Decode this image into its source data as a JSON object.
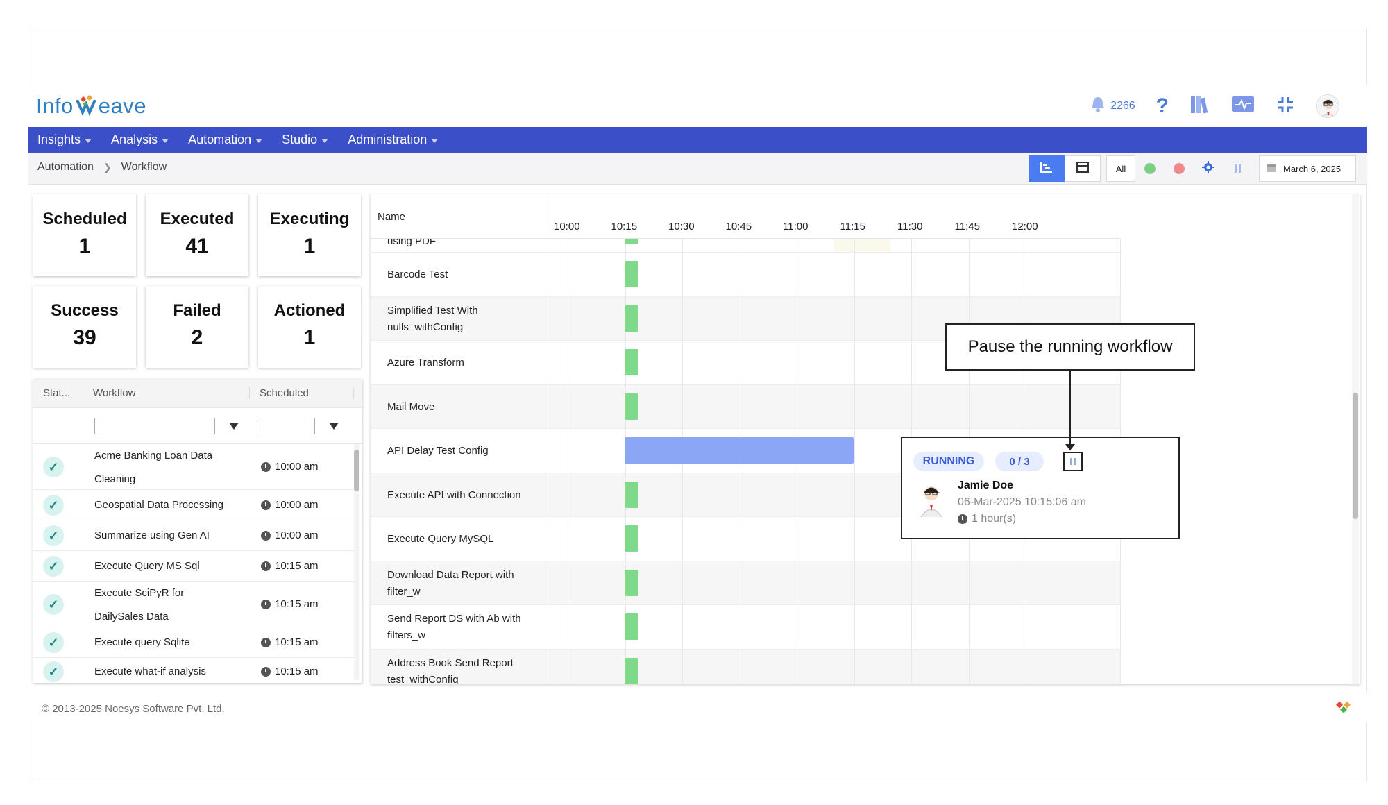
{
  "app": {
    "logo_prefix": "Info",
    "logo_suffix": "eave",
    "notifications_count": "2266"
  },
  "nav": {
    "items": [
      {
        "label": "Insights"
      },
      {
        "label": "Analysis"
      },
      {
        "label": "Automation"
      },
      {
        "label": "Studio"
      },
      {
        "label": "Administration"
      }
    ]
  },
  "breadcrumb": {
    "items": [
      "Automation",
      "Workflow"
    ]
  },
  "toolbar": {
    "filter_all": "All",
    "date": "March 6, 2025"
  },
  "stats": [
    {
      "title": "Scheduled",
      "value": "1"
    },
    {
      "title": "Executed",
      "value": "41"
    },
    {
      "title": "Executing",
      "value": "1"
    },
    {
      "title": "Success",
      "value": "39"
    },
    {
      "title": "Failed",
      "value": "2"
    },
    {
      "title": "Actioned",
      "value": "1"
    }
  ],
  "table": {
    "columns": [
      "Stat...",
      "Workflow",
      "Scheduled"
    ],
    "rows": [
      {
        "workflow": "Acme Banking Loan Data Cleaning",
        "scheduled": "10:00 am"
      },
      {
        "workflow": "Geospatial Data Processing",
        "scheduled": "10:00 am"
      },
      {
        "workflow": "Summarize using Gen AI",
        "scheduled": "10:00 am"
      },
      {
        "workflow": "Execute Query MS Sql",
        "scheduled": "10:15 am"
      },
      {
        "workflow": "Execute SciPyR for DailySales Data",
        "scheduled": "10:15 am"
      },
      {
        "workflow": "Execute query Sqlite",
        "scheduled": "10:15 am"
      },
      {
        "workflow": "Execute what-if analysis sales",
        "scheduled": "10:15 am"
      }
    ]
  },
  "gantt": {
    "name_header": "Name",
    "ticks": [
      "10:00",
      "10:15",
      "10:30",
      "10:45",
      "11:00",
      "11:15",
      "11:30",
      "11:45",
      "12:00"
    ],
    "partial_top_label": "using PDF",
    "rows": [
      {
        "name": "Barcode Test",
        "start": "10:15",
        "status": "success"
      },
      {
        "name": "Simplified Test With nulls_withConfig",
        "start": "10:15",
        "status": "success"
      },
      {
        "name": "Azure Transform",
        "start": "10:15",
        "status": "success"
      },
      {
        "name": "Mail Move",
        "start": "10:15",
        "status": "success"
      },
      {
        "name": "API Delay Test Config",
        "start": "10:15",
        "end": "11:15",
        "status": "running"
      },
      {
        "name": "Execute API with Connection",
        "start": "10:15",
        "status": "success"
      },
      {
        "name": "Execute Query MySQL",
        "start": "10:15",
        "status": "success"
      },
      {
        "name": "Download Data Report with filter_w",
        "start": "10:15",
        "status": "success"
      },
      {
        "name": "Send Report DS with Ab with filters_w",
        "start": "10:15",
        "status": "success"
      },
      {
        "name": "Address Book Send Report test_withConfig",
        "start": "10:15",
        "status": "success"
      }
    ]
  },
  "popup": {
    "status": "RUNNING",
    "progress": "0 / 3",
    "user": "Jamie Doe",
    "started": "06-Mar-2025 10:15:06 am",
    "duration": "1 hour(s)"
  },
  "callout": {
    "text": "Pause the running workflow"
  },
  "footer": {
    "copyright": "© 2013-2025 Noesys Software Pvt. Ltd."
  },
  "colors": {
    "nav": "#3b4fc9",
    "success_bar": "#7ed98a",
    "running_bar": "#8ba6f4",
    "accent": "#4a7bf0"
  }
}
